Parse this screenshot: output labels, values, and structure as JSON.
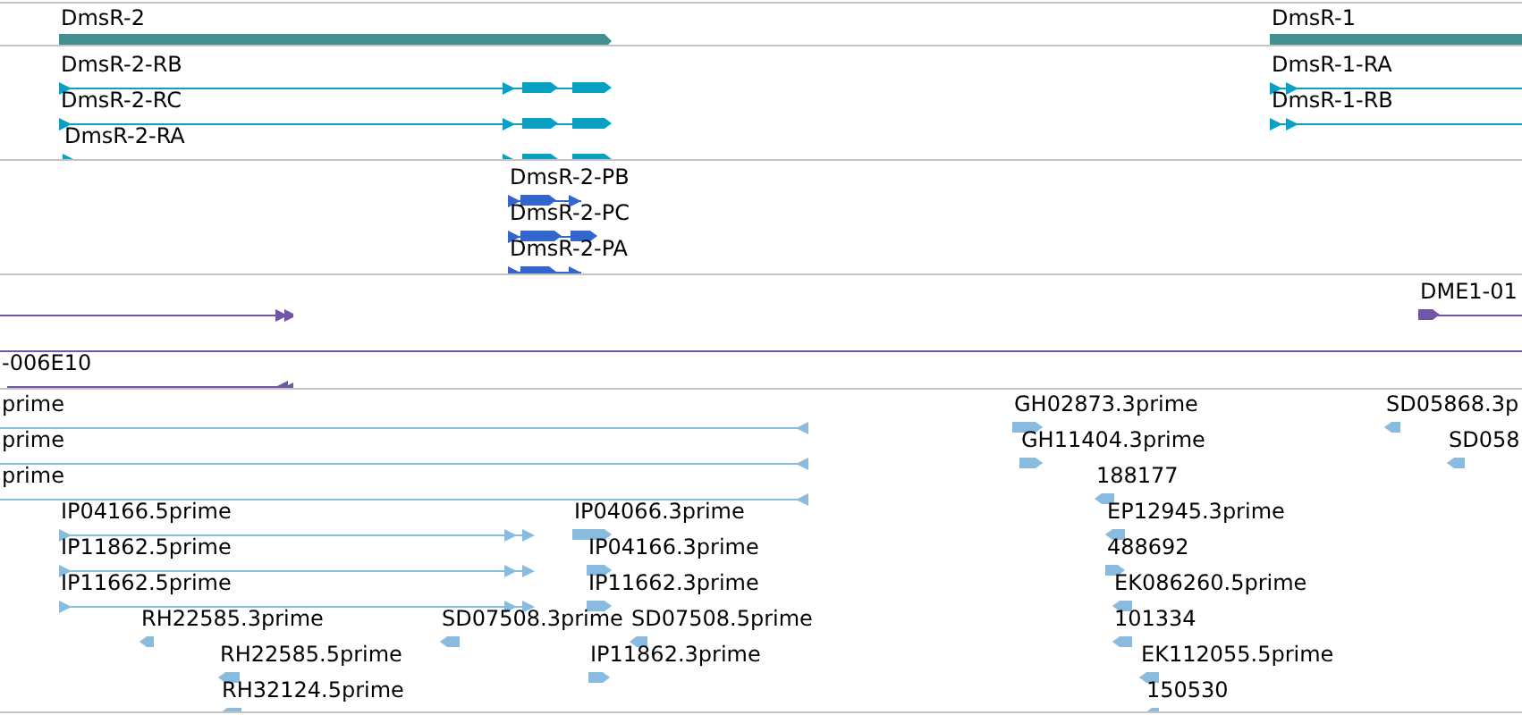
{
  "tracks": [
    {
      "features": [
        {
          "kind": "gene",
          "label": "DmsR-2",
          "reverse": false
        },
        {
          "kind": "gene",
          "label": "DmsR-1",
          "reverse": false
        }
      ]
    },
    {
      "features": [
        {
          "kind": "transcript",
          "label": "DmsR-2-RB",
          "reverse": false
        },
        {
          "kind": "transcript",
          "label": "DmsR-2-RC",
          "reverse": false
        },
        {
          "kind": "transcript",
          "label": "DmsR-2-RA",
          "reverse": false
        },
        {
          "kind": "transcript",
          "label": "DmsR-1-RA",
          "reverse": false
        },
        {
          "kind": "transcript",
          "label": "DmsR-1-RB",
          "reverse": false
        }
      ]
    },
    {
      "features": [
        {
          "kind": "protein",
          "label": "DmsR-2-PB",
          "reverse": false
        },
        {
          "kind": "protein",
          "label": "DmsR-2-PC",
          "reverse": false
        },
        {
          "kind": "protein",
          "label": "DmsR-2-PA",
          "reverse": false
        }
      ]
    },
    {
      "features": [
        {
          "kind": "clone",
          "reverse": false
        },
        {
          "kind": "clone",
          "label": "DME1-01",
          "reverse": false
        },
        {
          "kind": "clone"
        },
        {
          "kind": "clone",
          "label": "-006E10",
          "reverse": true
        }
      ]
    },
    {
      "features": [
        {
          "kind": "est",
          "label": "prime",
          "reverse": true
        },
        {
          "kind": "est",
          "label": "prime",
          "reverse": true
        },
        {
          "kind": "est",
          "label": "prime",
          "reverse": true
        },
        {
          "kind": "est",
          "label": "GH02873.3prime",
          "reverse": false
        },
        {
          "kind": "est",
          "label": "GH11404.3prime",
          "reverse": false
        },
        {
          "kind": "est",
          "label": "188177",
          "reverse": true
        },
        {
          "kind": "est",
          "label": "SD05868.3p",
          "reverse": true
        },
        {
          "kind": "est",
          "label": "SD058",
          "reverse": true
        },
        {
          "kind": "est",
          "label": "IP04166.5prime",
          "reverse": false
        },
        {
          "kind": "est",
          "label": "IP11862.5prime",
          "reverse": false
        },
        {
          "kind": "est",
          "label": "IP11662.5prime",
          "reverse": false
        },
        {
          "kind": "est",
          "label": "IP04066.3prime",
          "reverse": false
        },
        {
          "kind": "est",
          "label": "IP04166.3prime",
          "reverse": false
        },
        {
          "kind": "est",
          "label": "IP11662.3prime",
          "reverse": false
        },
        {
          "kind": "est",
          "label": "RH22585.3prime",
          "reverse": true
        },
        {
          "kind": "est",
          "label": "SD07508.3prime",
          "reverse": true
        },
        {
          "kind": "est",
          "label": "SD07508.5prime",
          "reverse": true
        },
        {
          "kind": "est",
          "label": "RH22585.5prime",
          "reverse": true
        },
        {
          "kind": "est",
          "label": "IP11862.3prime",
          "reverse": false
        },
        {
          "kind": "est",
          "label": "RH32124.5prime",
          "reverse": true
        },
        {
          "kind": "est",
          "label": "EP12945.3prime",
          "reverse": true
        },
        {
          "kind": "est",
          "label": "488692",
          "reverse": false
        },
        {
          "kind": "est",
          "label": "EK086260.5prime",
          "reverse": true
        },
        {
          "kind": "est",
          "label": "101334",
          "reverse": true
        },
        {
          "kind": "est",
          "label": "EK112055.5prime",
          "reverse": true
        },
        {
          "kind": "est",
          "label": "150530",
          "reverse": true
        }
      ]
    }
  ]
}
